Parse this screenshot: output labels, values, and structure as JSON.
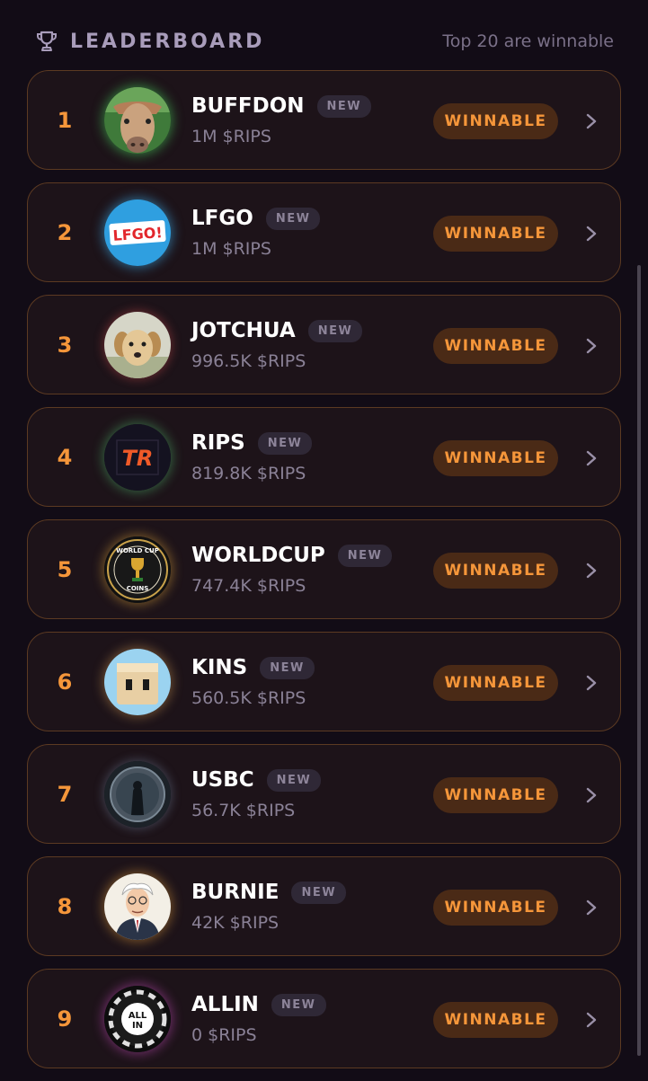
{
  "header": {
    "title": "LEADERBOARD",
    "note": "Top 20 are winnable",
    "icon": "trophy-icon"
  },
  "colors": {
    "accent": "#f5963a",
    "badge_bg": "#4a2a16",
    "card_border": "#5c3a22",
    "background": "#120c16"
  },
  "entries": [
    {
      "rank": "1",
      "name": "BUFFDON",
      "badge": "NEW",
      "amount": "1M $RIPS",
      "status": "WINNABLE",
      "avatar": "buffalo-avatar"
    },
    {
      "rank": "2",
      "name": "LFGO",
      "badge": "NEW",
      "amount": "1M $RIPS",
      "status": "WINNABLE",
      "avatar": "lfgo-logo-avatar",
      "avatar_text": "LFGO!"
    },
    {
      "rank": "3",
      "name": "JOTCHUA",
      "badge": "NEW",
      "amount": "996.5K $RIPS",
      "status": "WINNABLE",
      "avatar": "dog-avatar"
    },
    {
      "rank": "4",
      "name": "RIPS",
      "badge": "NEW",
      "amount": "819.8K $RIPS",
      "status": "WINNABLE",
      "avatar": "tr-logo-avatar",
      "avatar_text": "TR"
    },
    {
      "rank": "5",
      "name": "WORLDCUP",
      "badge": "NEW",
      "amount": "747.4K $RIPS",
      "status": "WINNABLE",
      "avatar": "worldcup-coin-avatar",
      "avatar_text_top": "WORLD CUP",
      "avatar_text_bottom": "COINS"
    },
    {
      "rank": "6",
      "name": "KINS",
      "badge": "NEW",
      "amount": "560.5K $RIPS",
      "status": "WINNABLE",
      "avatar": "block-face-avatar"
    },
    {
      "rank": "7",
      "name": "USBC",
      "badge": "NEW",
      "amount": "56.7K $RIPS",
      "status": "WINNABLE",
      "avatar": "coin-figure-avatar"
    },
    {
      "rank": "8",
      "name": "BURNIE",
      "badge": "NEW",
      "amount": "42K $RIPS",
      "status": "WINNABLE",
      "avatar": "cartoon-man-avatar"
    },
    {
      "rank": "9",
      "name": "ALLIN",
      "badge": "NEW",
      "amount": "0 $RIPS",
      "status": "WINNABLE",
      "avatar": "poker-chip-avatar",
      "avatar_text_top": "ALL",
      "avatar_text_bottom": "IN"
    }
  ]
}
